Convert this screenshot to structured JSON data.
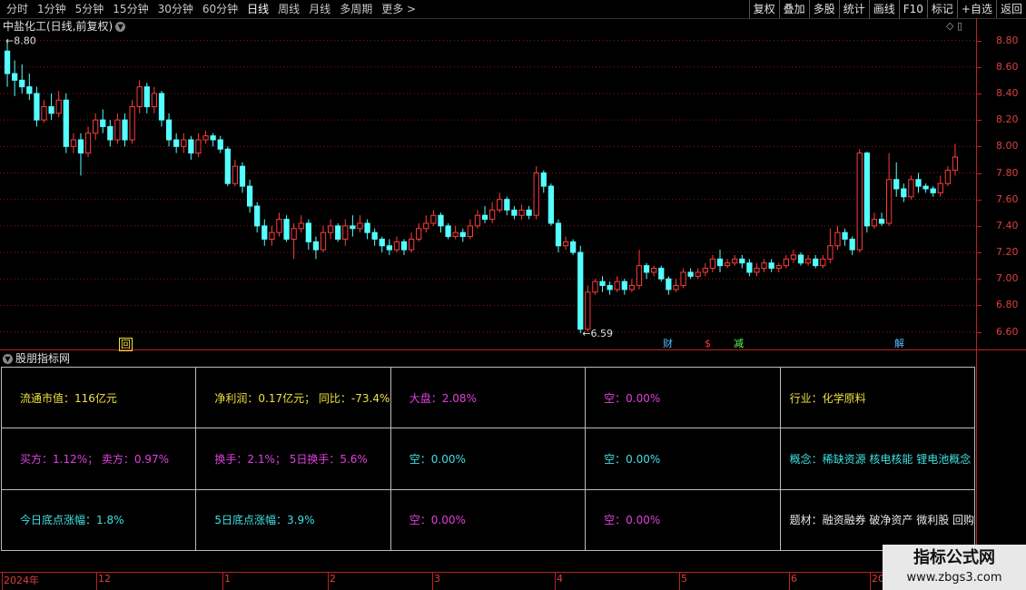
{
  "toolbar": {
    "periods": [
      "分时",
      "1分钟",
      "5分钟",
      "15分钟",
      "30分钟",
      "60分钟",
      "日线",
      "周线",
      "月线",
      "多周期",
      "更多 >"
    ],
    "active_period": "日线",
    "actions": [
      "复权",
      "叠加",
      "多股",
      "统计",
      "画线",
      "F10",
      "标记",
      "+自选",
      "返回"
    ]
  },
  "stock": {
    "title": "中盐化工(日线,前复权)"
  },
  "chart_data": {
    "type": "candlestick",
    "y_axis_ticks": [
      "8.80",
      "8.60",
      "8.40",
      "8.20",
      "8.00",
      "7.80",
      "7.60",
      "7.40",
      "7.20",
      "7.00",
      "6.80",
      "6.60"
    ],
    "ylim": [
      6.57,
      8.9
    ],
    "high_label": "8.80",
    "low_label": "6.59",
    "x_month_labels": [
      "2024年",
      "12",
      "1",
      "2",
      "3",
      "4",
      "5",
      "6",
      "20"
    ],
    "up_color": "#ff3c3c",
    "down_color": "#54ffff",
    "candles": [
      [
        8.72,
        8.55,
        8.8,
        8.45
      ],
      [
        8.55,
        8.5,
        8.65,
        8.38
      ],
      [
        8.5,
        8.45,
        8.62,
        8.4
      ],
      [
        8.45,
        8.4,
        8.55,
        8.35
      ],
      [
        8.4,
        8.2,
        8.45,
        8.15
      ],
      [
        8.2,
        8.3,
        8.35,
        8.18
      ],
      [
        8.3,
        8.25,
        8.4,
        8.2
      ],
      [
        8.25,
        8.35,
        8.42,
        8.22
      ],
      [
        8.35,
        8.0,
        8.4,
        7.95
      ],
      [
        8.0,
        8.05,
        8.1,
        7.95
      ],
      [
        8.05,
        7.95,
        8.1,
        7.78
      ],
      [
        7.95,
        8.1,
        8.15,
        7.92
      ],
      [
        8.1,
        8.2,
        8.25,
        8.05
      ],
      [
        8.2,
        8.15,
        8.28,
        8.1
      ],
      [
        8.15,
        8.05,
        8.2,
        8.0
      ],
      [
        8.05,
        8.2,
        8.25,
        8.02
      ],
      [
        8.2,
        8.05,
        8.25,
        8.0
      ],
      [
        8.05,
        8.3,
        8.35,
        8.02
      ],
      [
        8.3,
        8.45,
        8.5,
        8.25
      ],
      [
        8.45,
        8.3,
        8.48,
        8.25
      ],
      [
        8.3,
        8.4,
        8.45,
        8.25
      ],
      [
        8.4,
        8.2,
        8.42,
        8.15
      ],
      [
        8.2,
        8.05,
        8.25,
        8.0
      ],
      [
        8.05,
        8.0,
        8.1,
        7.95
      ],
      [
        8.0,
        8.05,
        8.1,
        7.95
      ],
      [
        8.05,
        7.95,
        8.08,
        7.9
      ],
      [
        7.95,
        8.05,
        8.1,
        7.92
      ],
      [
        8.05,
        8.08,
        8.12,
        8.02
      ],
      [
        8.08,
        8.05,
        8.1,
        8.0
      ],
      [
        8.05,
        7.98,
        8.08,
        7.95
      ],
      [
        7.98,
        7.72,
        8.0,
        7.7
      ],
      [
        7.72,
        7.85,
        7.9,
        7.7
      ],
      [
        7.85,
        7.7,
        7.88,
        7.65
      ],
      [
        7.7,
        7.55,
        7.75,
        7.5
      ],
      [
        7.55,
        7.4,
        7.58,
        7.35
      ],
      [
        7.4,
        7.3,
        7.45,
        7.25
      ],
      [
        7.3,
        7.35,
        7.4,
        7.25
      ],
      [
        7.35,
        7.45,
        7.5,
        7.32
      ],
      [
        7.45,
        7.3,
        7.48,
        7.28
      ],
      [
        7.3,
        7.38,
        7.42,
        7.15
      ],
      [
        7.38,
        7.42,
        7.48,
        7.35
      ],
      [
        7.42,
        7.28,
        7.45,
        7.22
      ],
      [
        7.28,
        7.22,
        7.32,
        7.15
      ],
      [
        7.22,
        7.35,
        7.4,
        7.2
      ],
      [
        7.35,
        7.4,
        7.45,
        7.3
      ],
      [
        7.4,
        7.3,
        7.42,
        7.28
      ],
      [
        7.3,
        7.4,
        7.45,
        7.25
      ],
      [
        7.4,
        7.38,
        7.48,
        7.32
      ],
      [
        7.38,
        7.42,
        7.48,
        7.35
      ],
      [
        7.42,
        7.35,
        7.45,
        7.3
      ],
      [
        7.35,
        7.3,
        7.38,
        7.25
      ],
      [
        7.3,
        7.25,
        7.32,
        7.2
      ],
      [
        7.25,
        7.22,
        7.3,
        7.18
      ],
      [
        7.22,
        7.28,
        7.32,
        7.2
      ],
      [
        7.28,
        7.22,
        7.3,
        7.18
      ],
      [
        7.22,
        7.3,
        7.35,
        7.2
      ],
      [
        7.3,
        7.38,
        7.42,
        7.28
      ],
      [
        7.38,
        7.42,
        7.48,
        7.35
      ],
      [
        7.42,
        7.48,
        7.52,
        7.4
      ],
      [
        7.48,
        7.4,
        7.5,
        7.35
      ],
      [
        7.4,
        7.32,
        7.42,
        7.3
      ],
      [
        7.32,
        7.35,
        7.4,
        7.3
      ],
      [
        7.35,
        7.32,
        7.38,
        7.28
      ],
      [
        7.32,
        7.4,
        7.45,
        7.3
      ],
      [
        7.4,
        7.48,
        7.52,
        7.38
      ],
      [
        7.48,
        7.45,
        7.55,
        7.42
      ],
      [
        7.45,
        7.52,
        7.58,
        7.42
      ],
      [
        7.52,
        7.6,
        7.65,
        7.5
      ],
      [
        7.6,
        7.52,
        7.62,
        7.48
      ],
      [
        7.52,
        7.48,
        7.55,
        7.45
      ],
      [
        7.48,
        7.52,
        7.56,
        7.45
      ],
      [
        7.52,
        7.48,
        7.55,
        7.45
      ],
      [
        7.48,
        7.8,
        7.85,
        7.45
      ],
      [
        7.8,
        7.7,
        7.82,
        7.65
      ],
      [
        7.7,
        7.42,
        7.72,
        7.4
      ],
      [
        7.42,
        7.25,
        7.45,
        7.2
      ],
      [
        7.25,
        7.28,
        7.32,
        7.22
      ],
      [
        7.28,
        7.2,
        7.3,
        7.18
      ],
      [
        7.2,
        6.62,
        7.25,
        6.59
      ],
      [
        6.62,
        6.9,
        6.95,
        6.6
      ],
      [
        6.9,
        6.98,
        7.0,
        6.88
      ],
      [
        6.98,
        6.95,
        7.02,
        6.9
      ],
      [
        6.95,
        6.92,
        6.98,
        6.88
      ],
      [
        6.92,
        6.98,
        7.02,
        6.9
      ],
      [
        6.98,
        6.92,
        7.0,
        6.88
      ],
      [
        6.92,
        6.95,
        7.0,
        6.9
      ],
      [
        6.95,
        7.1,
        7.22,
        6.92
      ],
      [
        7.1,
        7.05,
        7.12,
        7.0
      ],
      [
        7.05,
        7.08,
        7.1,
        7.02
      ],
      [
        7.08,
        7.0,
        7.1,
        6.98
      ],
      [
        7.0,
        6.92,
        7.02,
        6.88
      ],
      [
        6.92,
        6.95,
        7.0,
        6.9
      ],
      [
        6.95,
        7.05,
        7.08,
        6.93
      ],
      [
        7.05,
        7.02,
        7.08,
        7.0
      ],
      [
        7.02,
        7.05,
        7.08,
        7.0
      ],
      [
        7.05,
        7.08,
        7.12,
        7.02
      ],
      [
        7.08,
        7.15,
        7.18,
        7.05
      ],
      [
        7.15,
        7.1,
        7.22,
        7.05
      ],
      [
        7.1,
        7.12,
        7.15,
        7.08
      ],
      [
        7.12,
        7.15,
        7.18,
        7.1
      ],
      [
        7.15,
        7.12,
        7.18,
        7.08
      ],
      [
        7.12,
        7.05,
        7.15,
        7.02
      ],
      [
        7.05,
        7.08,
        7.12,
        7.02
      ],
      [
        7.08,
        7.12,
        7.15,
        7.05
      ],
      [
        7.12,
        7.08,
        7.15,
        7.05
      ],
      [
        7.08,
        7.1,
        7.12,
        7.05
      ],
      [
        7.1,
        7.15,
        7.18,
        7.08
      ],
      [
        7.15,
        7.18,
        7.22,
        7.12
      ],
      [
        7.18,
        7.12,
        7.2,
        7.1
      ],
      [
        7.12,
        7.15,
        7.18,
        7.1
      ],
      [
        7.15,
        7.1,
        7.18,
        7.08
      ],
      [
        7.1,
        7.15,
        7.18,
        7.08
      ],
      [
        7.15,
        7.25,
        7.38,
        7.12
      ],
      [
        7.25,
        7.35,
        7.4,
        7.22
      ],
      [
        7.35,
        7.3,
        7.38,
        7.25
      ],
      [
        7.3,
        7.22,
        7.32,
        7.18
      ],
      [
        7.22,
        7.95,
        7.98,
        7.2
      ],
      [
        7.95,
        7.4,
        7.96,
        7.35
      ],
      [
        7.4,
        7.45,
        7.5,
        7.38
      ],
      [
        7.45,
        7.42,
        7.5,
        7.4
      ],
      [
        7.42,
        7.75,
        7.95,
        7.4
      ],
      [
        7.75,
        7.68,
        7.88,
        7.62
      ],
      [
        7.68,
        7.62,
        7.72,
        7.58
      ],
      [
        7.62,
        7.75,
        7.78,
        7.6
      ],
      [
        7.75,
        7.7,
        7.8,
        7.65
      ],
      [
        7.7,
        7.68,
        7.72,
        7.65
      ],
      [
        7.68,
        7.65,
        7.7,
        7.62
      ],
      [
        7.65,
        7.72,
        7.78,
        7.62
      ],
      [
        7.72,
        7.82,
        7.85,
        7.7
      ],
      [
        7.82,
        7.92,
        8.02,
        7.78
      ]
    ]
  },
  "markers": {
    "hui": "回",
    "cai": "财",
    "s": "$",
    "jian": "减",
    "jie": "解"
  },
  "indicator": {
    "title": "股朋指标网",
    "cells": [
      [
        "流通市值：116亿元",
        "净利润：0.17亿元；  同比：-73.4%",
        "大盘：2.08%",
        "空：0.00%",
        "行业：化学原料"
      ],
      [
        "买方：1.12%；    卖方：0.97%",
        "换手：2.1%；    5日换手：5.6%",
        "空：0.00%",
        "空：0.00%",
        "概念：稀缺资源 核电核能 锂电池概念"
      ],
      [
        "今日底点涨幅：1.8%",
        "5日底点涨幅：3.9%",
        "空：0.00%",
        "空：0.00%",
        "题材：融资融券 破净资产 微利股 回购"
      ]
    ]
  },
  "watermark": {
    "line1": "指标公式网",
    "line2": "www.zbgs3.com"
  }
}
